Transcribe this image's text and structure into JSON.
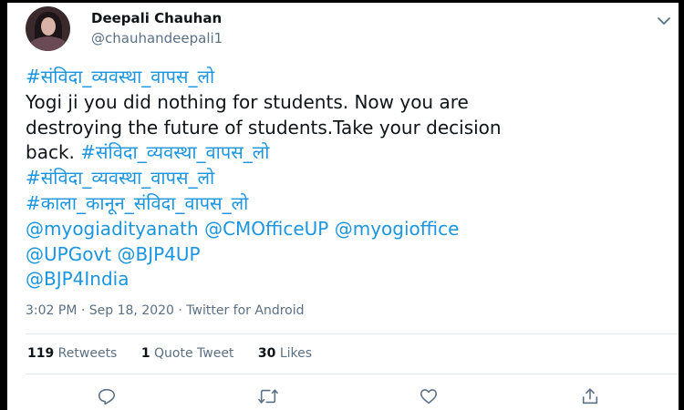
{
  "user": {
    "display_name": "Deepali Chauhan",
    "handle": "@chauhandeepali1"
  },
  "tweet": {
    "lines": [
      [
        {
          "text": "#संविदा_व्यवस्था_वापस_लो",
          "link": true
        }
      ],
      [
        {
          "text": "Yogi ji you did nothing for students. Now you are",
          "link": false
        }
      ],
      [
        {
          "text": "destroying the future of students.Take your decision",
          "link": false
        }
      ],
      [
        {
          "text": "back. ",
          "link": false
        },
        {
          "text": "#संविदा_व्यवस्था_वापस_लो",
          "link": true
        }
      ],
      [
        {
          "text": "#संविदा_व्यवस्था_वापस_लो",
          "link": true
        }
      ],
      [
        {
          "text": "#काला_कानून_संविदा_वापस_लो",
          "link": true
        }
      ],
      [
        {
          "text": "@myogiadityanath",
          "link": true
        },
        {
          "text": " ",
          "link": false
        },
        {
          "text": "@CMOfficeUP",
          "link": true
        },
        {
          "text": " ",
          "link": false
        },
        {
          "text": "@myogioffice",
          "link": true
        }
      ],
      [
        {
          "text": "@UPGovt",
          "link": true
        },
        {
          "text": " ",
          "link": false
        },
        {
          "text": "@BJP4UP",
          "link": true
        }
      ],
      [
        {
          "text": "@BJP4India",
          "link": true
        }
      ]
    ]
  },
  "meta": {
    "text": "3:02 PM · Sep 18, 2020 · Twitter for Android"
  },
  "stats": {
    "retweets_count": "119",
    "retweets_label": " Retweets",
    "quotes_count": "1",
    "quotes_label": " Quote Tweet",
    "likes_count": "30",
    "likes_label": " Likes"
  },
  "icons": {
    "more": "chevron-down-icon",
    "reply": "reply-icon",
    "retweet": "retweet-icon",
    "like": "heart-icon",
    "share": "share-icon"
  },
  "colors": {
    "link": "#1b95e0",
    "text": "#0f1419",
    "muted": "#5b7083",
    "border": "#000000"
  }
}
